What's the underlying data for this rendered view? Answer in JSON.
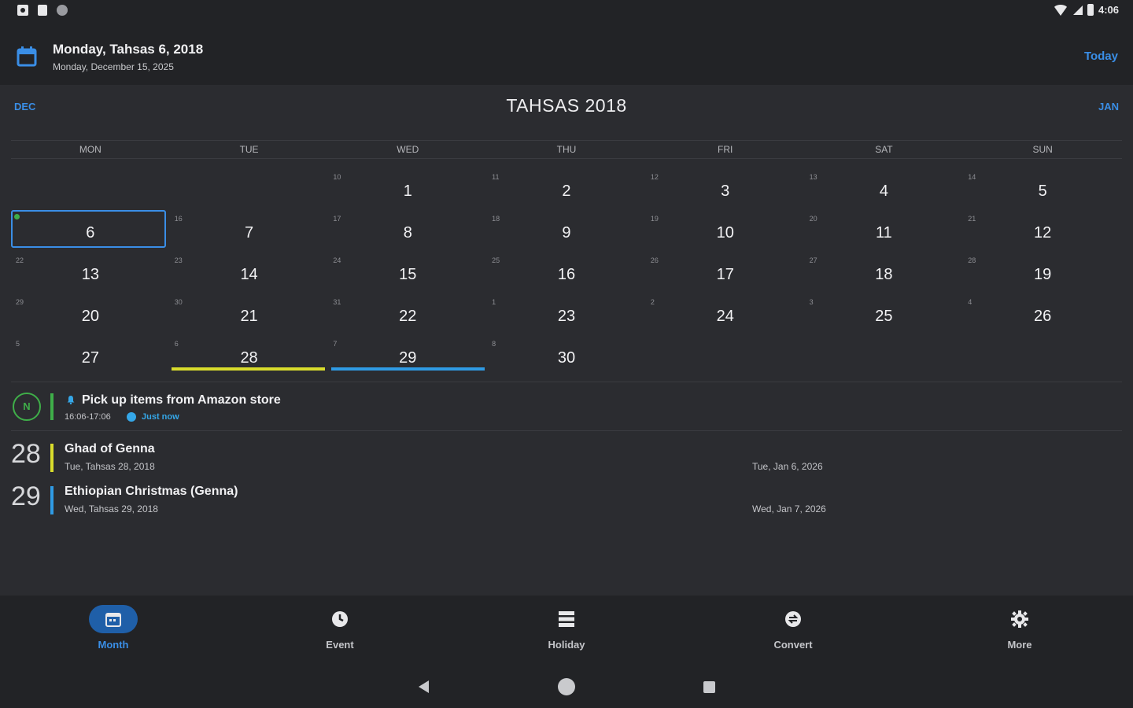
{
  "status_bar": {
    "time": "4:06"
  },
  "header": {
    "title": "Monday, Tahsas 6, 2018",
    "subtitle": "Monday, December 15, 2025",
    "today_label": "Today"
  },
  "month_nav": {
    "prev_label": "DEC",
    "title": "TAHSAS 2018",
    "next_label": "JAN"
  },
  "weekdays": [
    "MON",
    "TUE",
    "WED",
    "THU",
    "FRI",
    "SAT",
    "SUN"
  ],
  "weeks": [
    [
      {
        "num": "",
        "sub": ""
      },
      {
        "num": "",
        "sub": ""
      },
      {
        "num": "1",
        "sub": "10"
      },
      {
        "num": "2",
        "sub": "11"
      },
      {
        "num": "3",
        "sub": "12"
      },
      {
        "num": "4",
        "sub": "13"
      },
      {
        "num": "5",
        "sub": "14"
      }
    ],
    [
      {
        "num": "6",
        "sub": ""
      },
      {
        "num": "7",
        "sub": "16"
      },
      {
        "num": "8",
        "sub": "17"
      },
      {
        "num": "9",
        "sub": "18"
      },
      {
        "num": "10",
        "sub": "19"
      },
      {
        "num": "11",
        "sub": "20"
      },
      {
        "num": "12",
        "sub": "21"
      }
    ],
    [
      {
        "num": "13",
        "sub": "22"
      },
      {
        "num": "14",
        "sub": "23"
      },
      {
        "num": "15",
        "sub": "24"
      },
      {
        "num": "16",
        "sub": "25"
      },
      {
        "num": "17",
        "sub": "26"
      },
      {
        "num": "18",
        "sub": "27"
      },
      {
        "num": "19",
        "sub": "28"
      }
    ],
    [
      {
        "num": "20",
        "sub": "29"
      },
      {
        "num": "21",
        "sub": "30"
      },
      {
        "num": "22",
        "sub": "31"
      },
      {
        "num": "23",
        "sub": "1"
      },
      {
        "num": "24",
        "sub": "2"
      },
      {
        "num": "25",
        "sub": "3"
      },
      {
        "num": "26",
        "sub": "4"
      }
    ],
    [
      {
        "num": "27",
        "sub": "5"
      },
      {
        "num": "28",
        "sub": "6"
      },
      {
        "num": "29",
        "sub": "7"
      },
      {
        "num": "30",
        "sub": "8"
      },
      {
        "num": "",
        "sub": ""
      },
      {
        "num": "",
        "sub": ""
      },
      {
        "num": "",
        "sub": ""
      }
    ]
  ],
  "selected_day": "6",
  "reminder": {
    "badge": "N",
    "title": "Pick up items from Amazon store",
    "time": "16:06-17:06",
    "status": "Just now",
    "color": "#3fae49"
  },
  "holidays": [
    {
      "day": "28",
      "name": "Ghad of Genna",
      "ethiopian_date": "Tue, Tahsas 28, 2018",
      "gregorian_date": "Tue, Jan 6, 2026",
      "color": "#d9dd2c"
    },
    {
      "day": "29",
      "name": "Ethiopian Christmas (Genna)",
      "ethiopian_date": "Wed, Tahsas 29, 2018",
      "gregorian_date": "Wed, Jan 7, 2026",
      "color": "#2f9be4"
    }
  ],
  "bottom_nav": [
    {
      "label": "Month",
      "icon": "calendar-icon",
      "active": true
    },
    {
      "label": "Event",
      "icon": "clock-icon",
      "active": false
    },
    {
      "label": "Holiday",
      "icon": "list-icon",
      "active": false
    },
    {
      "label": "Convert",
      "icon": "convert-icon",
      "active": false
    },
    {
      "label": "More",
      "icon": "gear-icon",
      "active": false
    }
  ],
  "colors": {
    "accent": "#3a8ee6",
    "background": "#2b2c30",
    "bar": "#222326"
  }
}
